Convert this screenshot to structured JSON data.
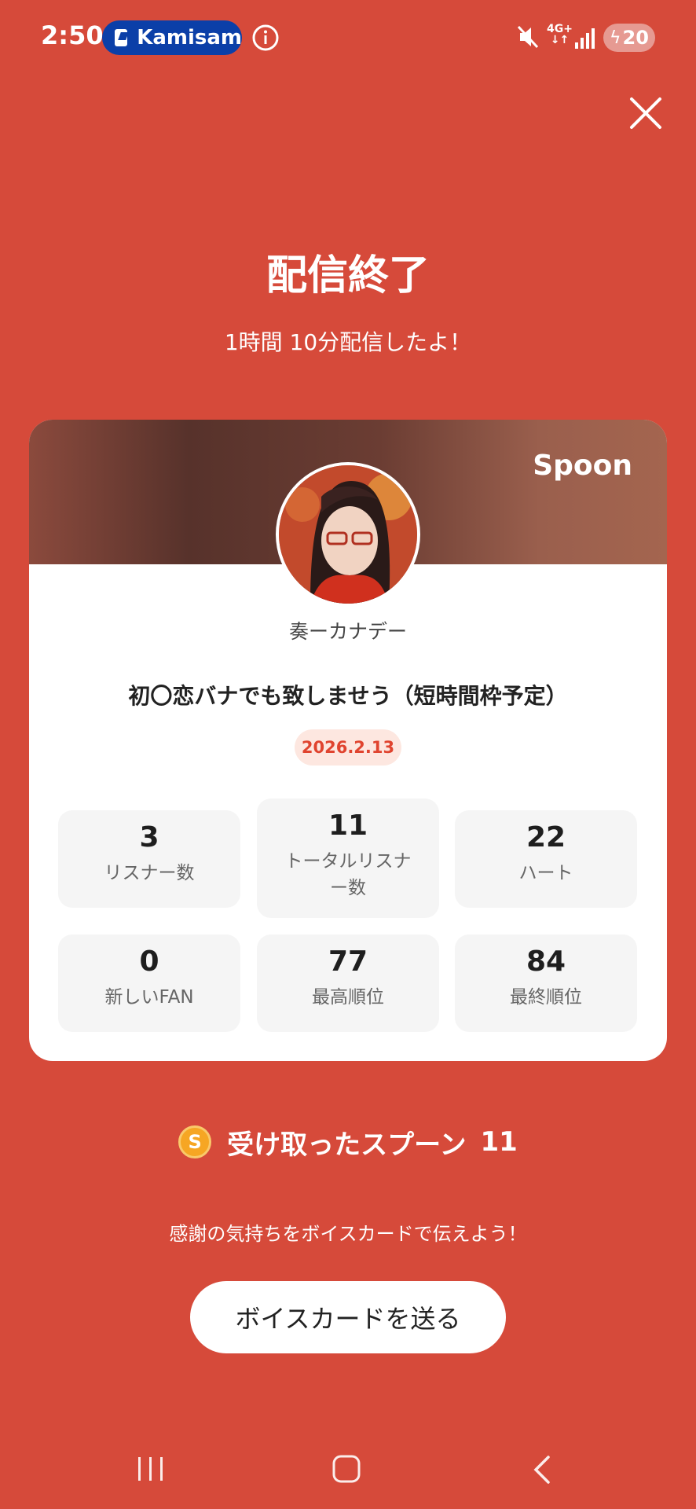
{
  "status_bar": {
    "time": "2:50",
    "app_pill_label": "Kamisam",
    "network": "4G+",
    "battery": "20"
  },
  "header": {
    "title": "配信終了",
    "duration": "1時間 10分配信したよ！"
  },
  "card": {
    "brand": "Spoon",
    "host_name": "奏ーカナデー",
    "stream_title": "初〇恋バナでも致しませう（短時間枠予定）",
    "date": "2026.2.13",
    "stats": [
      {
        "value": "3",
        "label": "リスナー数"
      },
      {
        "value": "11",
        "label": "トータルリスナー数"
      },
      {
        "value": "22",
        "label": "ハート"
      },
      {
        "value": "0",
        "label": "新しいFAN"
      },
      {
        "value": "77",
        "label": "最高順位"
      },
      {
        "value": "84",
        "label": "最終順位"
      }
    ]
  },
  "spoons": {
    "coin_glyph": "S",
    "label": "受け取ったスプーン",
    "count": "11"
  },
  "thanks_text": "感謝の気持ちをボイスカードで伝えよう！",
  "voice_card_button": "ボイスカードを送る",
  "colors": {
    "background": "#d64a3a",
    "accent": "#e0442f",
    "coin": "#f6a623"
  }
}
